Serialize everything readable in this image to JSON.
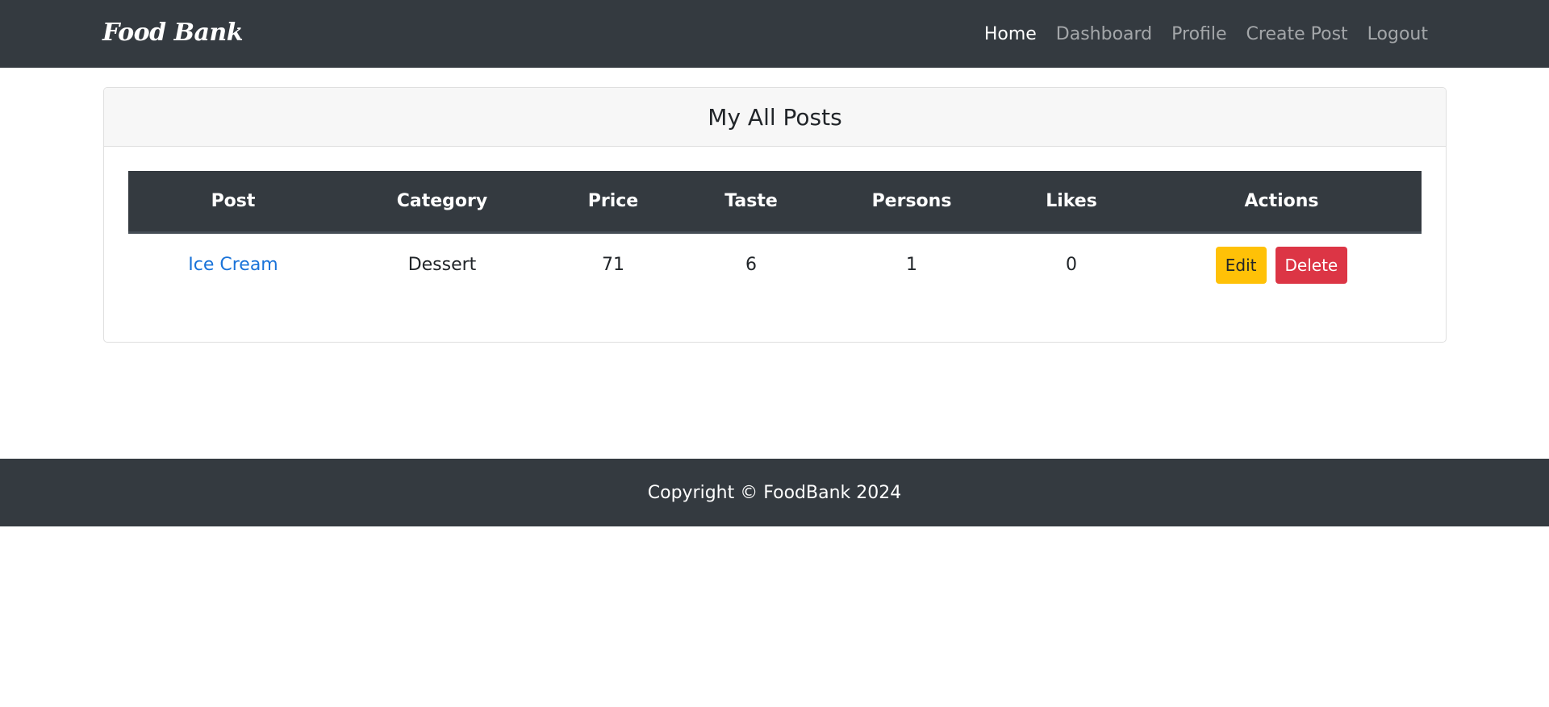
{
  "navbar": {
    "brand": "Food Bank",
    "links": [
      {
        "label": "Home",
        "active": true
      },
      {
        "label": "Dashboard",
        "active": false
      },
      {
        "label": "Profile",
        "active": false
      },
      {
        "label": "Create Post",
        "active": false
      },
      {
        "label": "Logout",
        "active": false
      }
    ]
  },
  "card": {
    "title": "My All Posts"
  },
  "table": {
    "headers": [
      "Post",
      "Category",
      "Price",
      "Taste",
      "Persons",
      "Likes",
      "Actions"
    ],
    "rows": [
      {
        "post": "Ice Cream",
        "category": "Dessert",
        "price": "71",
        "taste": "6",
        "persons": "1",
        "likes": "0",
        "edit_label": "Edit",
        "delete_label": "Delete"
      }
    ]
  },
  "footer": {
    "text": "Copyright © FoodBank 2024"
  },
  "colors": {
    "navbar_bg": "#343a40",
    "link": "#1a73d9",
    "edit_button": "#ffc107",
    "delete_button": "#dc3545"
  }
}
